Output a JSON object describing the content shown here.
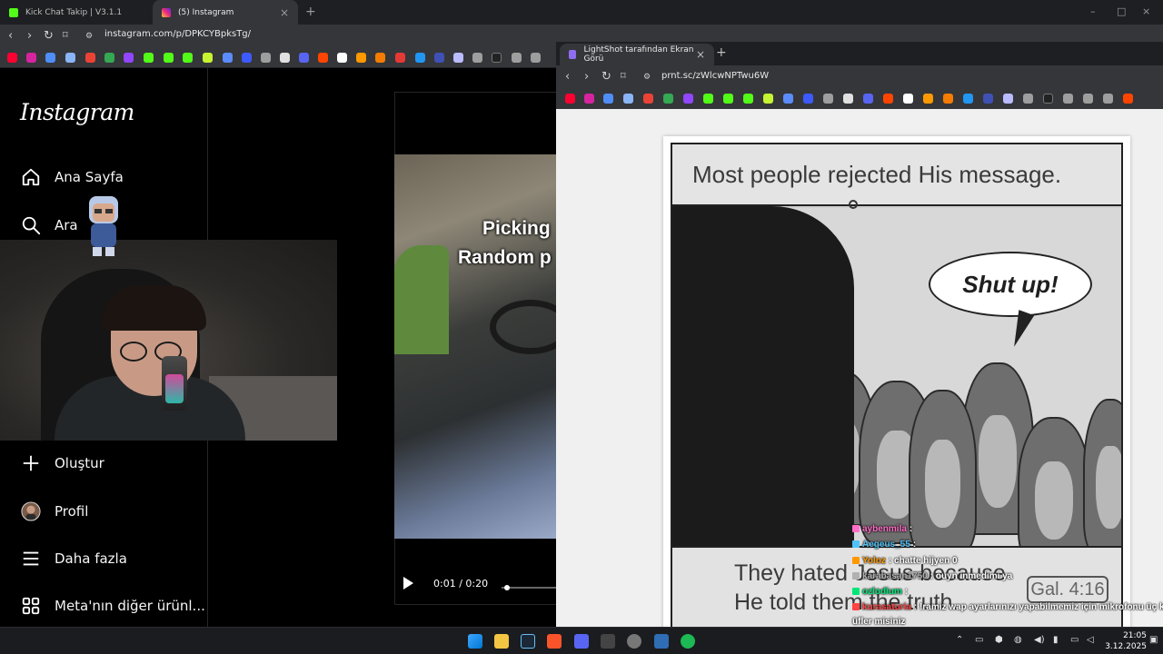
{
  "browser": {
    "tabs": [
      {
        "title": "Kick Chat Takip | V3.1.1"
      },
      {
        "title": "(5) Instagram"
      }
    ],
    "url": "instagram.com/p/DPKCYBpksTg/"
  },
  "instagram": {
    "logo": "Instagram",
    "nav": [
      {
        "label": "Ana Sayfa",
        "icon": "home-icon"
      },
      {
        "label": "Ara",
        "icon": "search-icon"
      },
      {
        "label": "Oluştur",
        "icon": "plus-icon"
      },
      {
        "label": "Profil",
        "icon": "avatar"
      },
      {
        "label": "Daha fazla",
        "icon": "menu-icon"
      },
      {
        "label": "Meta'nın diğer ürünl...",
        "icon": "apps-grid-icon"
      }
    ],
    "video": {
      "caption_line1": "Picking",
      "caption_line2": "Random p",
      "time": "0:01 / 0:20",
      "progress": 0.05
    }
  },
  "second_window": {
    "tab_title": "LightShot tarafından Ekran Görü",
    "url": "prnt.sc/zWlcwNPTwu6W"
  },
  "comic": {
    "top_text": "Most people rejected His message.",
    "bubble_text": "Shut up!",
    "bottom_line1": "They hated Jesus because",
    "bottom_line2": "He told them the truth.",
    "verse": "Gal. 4:16"
  },
  "chat": [
    {
      "user": "aybenmila",
      "message": ":",
      "color": "#ff6ec7"
    },
    {
      "user": "Aegeus_55",
      "message": ":",
      "color": "#4fc3f7"
    },
    {
      "user": "Yoloz",
      "message": ": chatte hijyen 0",
      "color": "#ff9800"
    },
    {
      "user": "karabasan1750",
      "message": ": ouyn inmedimi ya",
      "color": "#b0b0b0"
    },
    {
      "user": "ozlodium",
      "message": ":",
      "color": "#00e676"
    },
    {
      "user": "kurasaturia",
      "message": ": !ramiz wap ayarlarınızı yapabilmemiz için mikrofonu üç kez",
      "color": "#ff4444"
    },
    {
      "user": "",
      "message": "üfler misiniz",
      "color": "#ffffff"
    }
  ],
  "taskbar": {
    "time": "21:05",
    "date": "3.12.2025"
  },
  "colors": {
    "chrome_dark": "#1e1f22",
    "chrome_toolbar": "#35363a",
    "instagram_bg": "#000000"
  }
}
